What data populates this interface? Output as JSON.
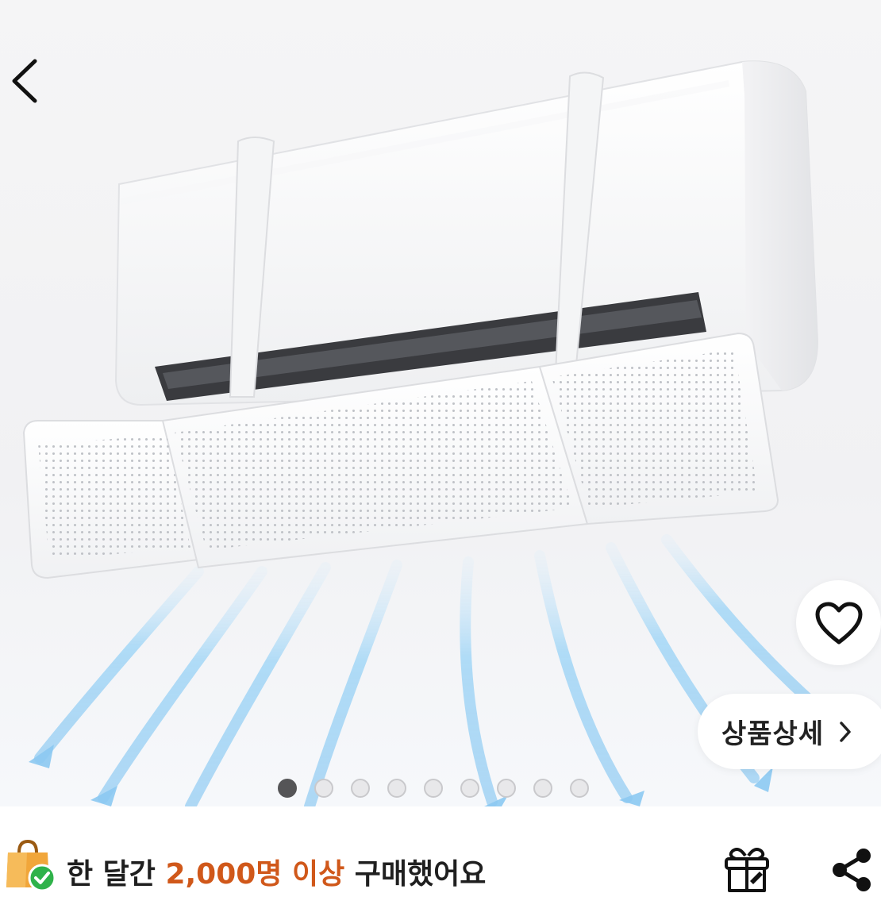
{
  "nav": {
    "back_icon": "chevron-left-icon"
  },
  "product_image": {
    "subject": "air-conditioner-wind-deflector"
  },
  "actions": {
    "favorite_icon": "heart-outline-icon",
    "detail_label": "상품상세",
    "detail_icon": "chevron-right-icon"
  },
  "carousel": {
    "total": 9,
    "active_index": 0
  },
  "purchase_info": {
    "prefix": "한 달간 ",
    "highlight": "2,000명 이상",
    "suffix": " 구매했어요"
  },
  "colors": {
    "highlight": "#d0581a",
    "bag": "#f1a63a",
    "badge": "#2fb24a",
    "airflow": "#7cc3f1"
  },
  "icons": {
    "bag": "shopping-bag-check-icon",
    "gift": "gift-icon",
    "share": "share-icon"
  }
}
